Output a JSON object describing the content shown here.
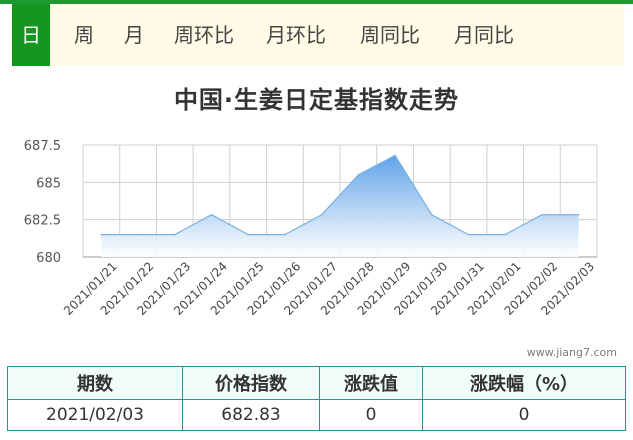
{
  "tabs": [
    {
      "label": "日",
      "active": true
    },
    {
      "label": "周",
      "active": false
    },
    {
      "label": "月",
      "active": false
    },
    {
      "label": "周环比",
      "active": false
    },
    {
      "label": "月环比",
      "active": false
    },
    {
      "label": "周同比",
      "active": false
    },
    {
      "label": "月同比",
      "active": false
    }
  ],
  "watermark": "www.jiang7.com",
  "colors": {
    "accent": "#14961f",
    "line": "#7ab0e6",
    "fill_top": "#6faeea",
    "table_border": "#2f8f8a"
  },
  "chart_data": {
    "type": "area",
    "title": "中国·生姜日定基指数走势",
    "x": [
      "2021/01/21",
      "2021/01/22",
      "2021/01/23",
      "2021/01/24",
      "2021/01/25",
      "2021/01/26",
      "2021/01/27",
      "2021/01/28",
      "2021/01/29",
      "2021/01/30",
      "2021/01/31",
      "2021/02/01",
      "2021/02/02",
      "2021/02/03"
    ],
    "values": [
      681.5,
      681.5,
      681.5,
      682.83,
      681.5,
      681.5,
      682.83,
      685.5,
      686.8,
      682.83,
      681.5,
      681.5,
      682.83,
      682.83
    ],
    "yticks": [
      "680",
      "682.5",
      "685",
      "687.5"
    ],
    "ylim": [
      680,
      687.5
    ],
    "grid": true,
    "xlabel": "",
    "ylabel": ""
  },
  "table": {
    "headers": [
      "期数",
      "价格指数",
      "涨跌值",
      "涨跌幅（%）"
    ],
    "rows": [
      [
        "2021/02/03",
        "682.83",
        "0",
        "0"
      ]
    ]
  }
}
